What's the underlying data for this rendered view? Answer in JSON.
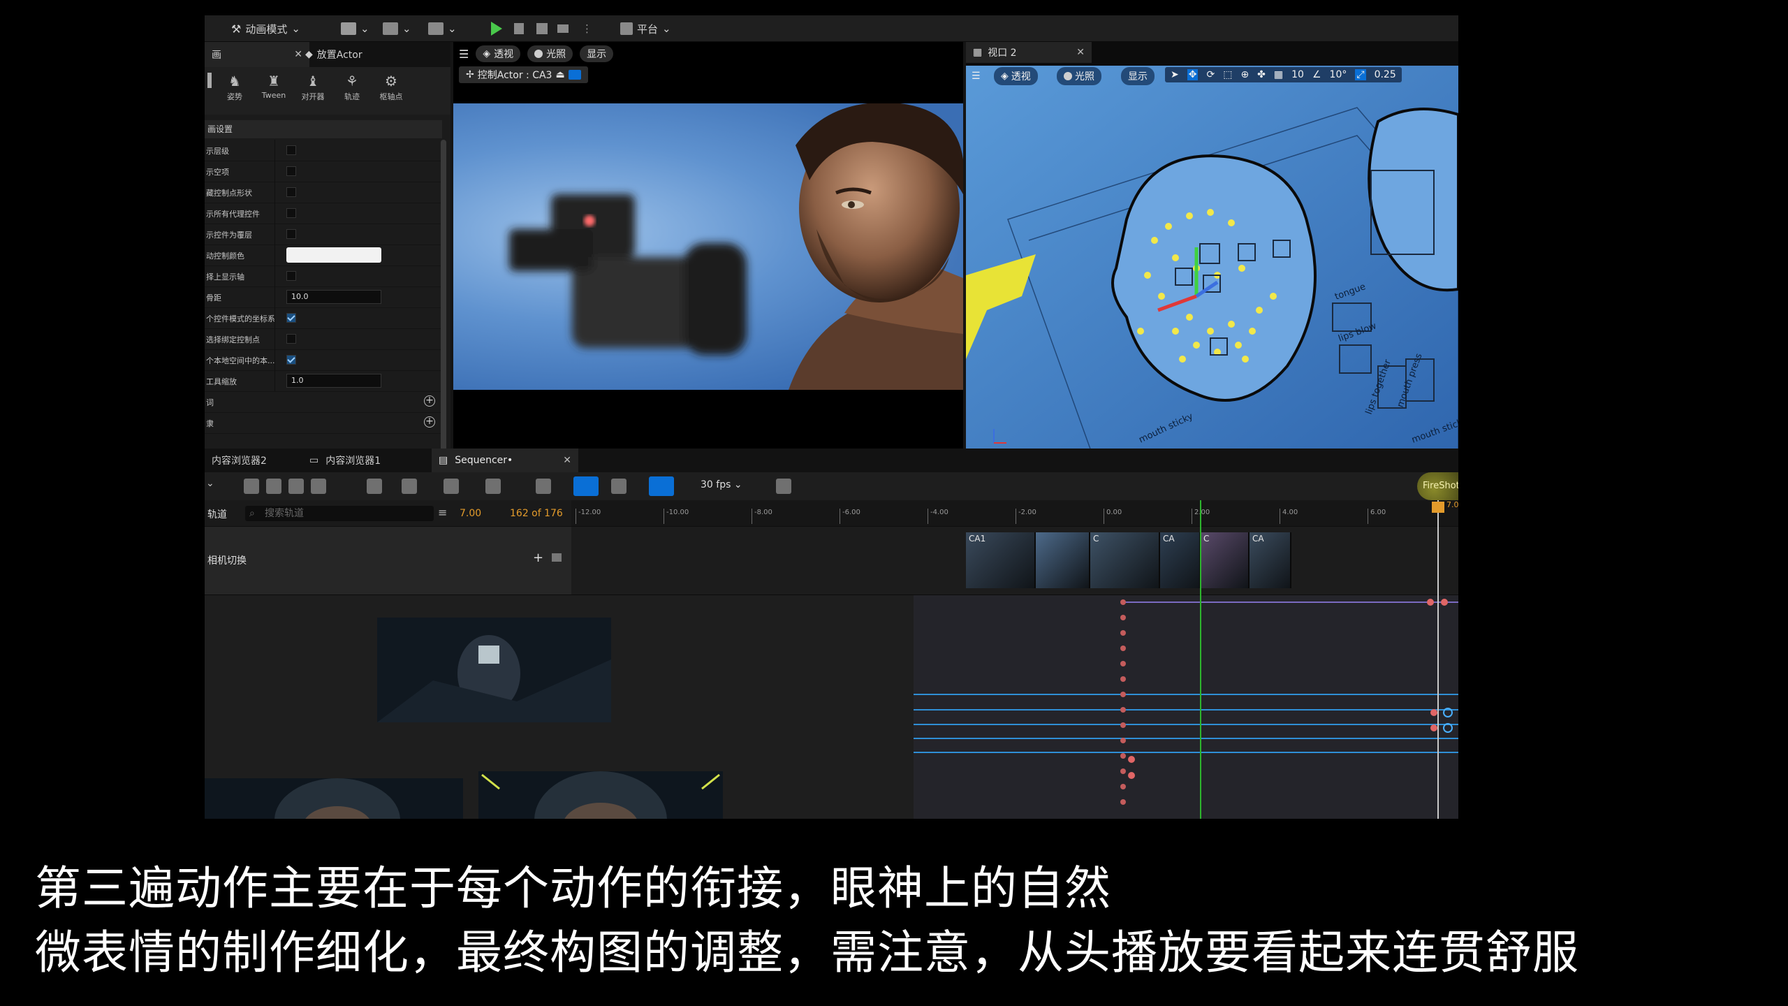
{
  "toolbar": {
    "mode_label": "动画模式",
    "platform_label": "平台"
  },
  "left_panel": {
    "tab1_label": "画",
    "tab2_label": "放置Actor",
    "tools": [
      "姿势",
      "Tween",
      "对开器",
      "轨迹",
      "枢轴点"
    ],
    "section_header": "画设置",
    "rows": [
      {
        "label": "示层级",
        "type": "checkbox",
        "checked": false
      },
      {
        "label": "示空项",
        "type": "checkbox",
        "checked": false
      },
      {
        "label": "藏控制点形状",
        "type": "checkbox",
        "checked": false
      },
      {
        "label": "示所有代理控件",
        "type": "checkbox",
        "checked": false
      },
      {
        "label": "示控件为覆层",
        "type": "checkbox",
        "checked": false
      },
      {
        "label": "动控制颜色",
        "type": "color",
        "value": "#f2f2f2"
      },
      {
        "label": "择上显示轴",
        "type": "checkbox",
        "checked": false
      },
      {
        "label": "骨距",
        "type": "number",
        "value": "10.0"
      },
      {
        "label": "个控件模式的坐标系",
        "type": "checkbox",
        "checked": true
      },
      {
        "label": "选择绑定控制点",
        "type": "checkbox",
        "checked": false
      },
      {
        "label": "个本地空间中的本...",
        "type": "checkbox",
        "checked": true
      },
      {
        "label": "工具缩放",
        "type": "number",
        "value": "1.0"
      },
      {
        "label": "词",
        "type": "add"
      },
      {
        "label": "隶",
        "type": "add"
      }
    ]
  },
  "viewport1": {
    "perspective_label": "透视",
    "lighting_label": "光照",
    "show_label": "显示",
    "pilot_label": "控制Actor : CA3"
  },
  "viewport2": {
    "tab_label": "视口 2",
    "perspective_label": "透视",
    "lighting_label": "光照",
    "show_label": "显示",
    "grid_value": "10",
    "angle_value": "10°",
    "scale_value": "0.25",
    "sheet_labels": [
      "mouth sticky",
      "tongue",
      "lips blow",
      "lips together",
      "mouth press",
      "mouth stick"
    ]
  },
  "lower_tabs": [
    "内容浏览器2",
    "内容浏览器1",
    "Sequencer•"
  ],
  "sequencer": {
    "fps_label": "30 fps",
    "tracks_label": "轨道",
    "search_placeholder": "搜索轨道",
    "current_frame": "7.00",
    "frame_count": "162 of 176",
    "camera_cut_label": "相机切换",
    "fireshot_label": "FireShot",
    "playhead_label": "7.0",
    "ruler_ticks": [
      "-12.00",
      "-10.00",
      "-8.00",
      "-6.00",
      "-4.00",
      "-2.00",
      "0.00",
      "2.00",
      "4.00",
      "6.00"
    ],
    "shot_labels": [
      "CA1",
      "",
      "C",
      "CA",
      "C",
      "CA"
    ]
  },
  "subtitles": {
    "line1": "第三遍动作主要在于每个动作的衔接，眼神上的自然",
    "line2": "微表情的制作细化，最终构图的调整，需注意，从头播放要看起来连贯舒服"
  }
}
